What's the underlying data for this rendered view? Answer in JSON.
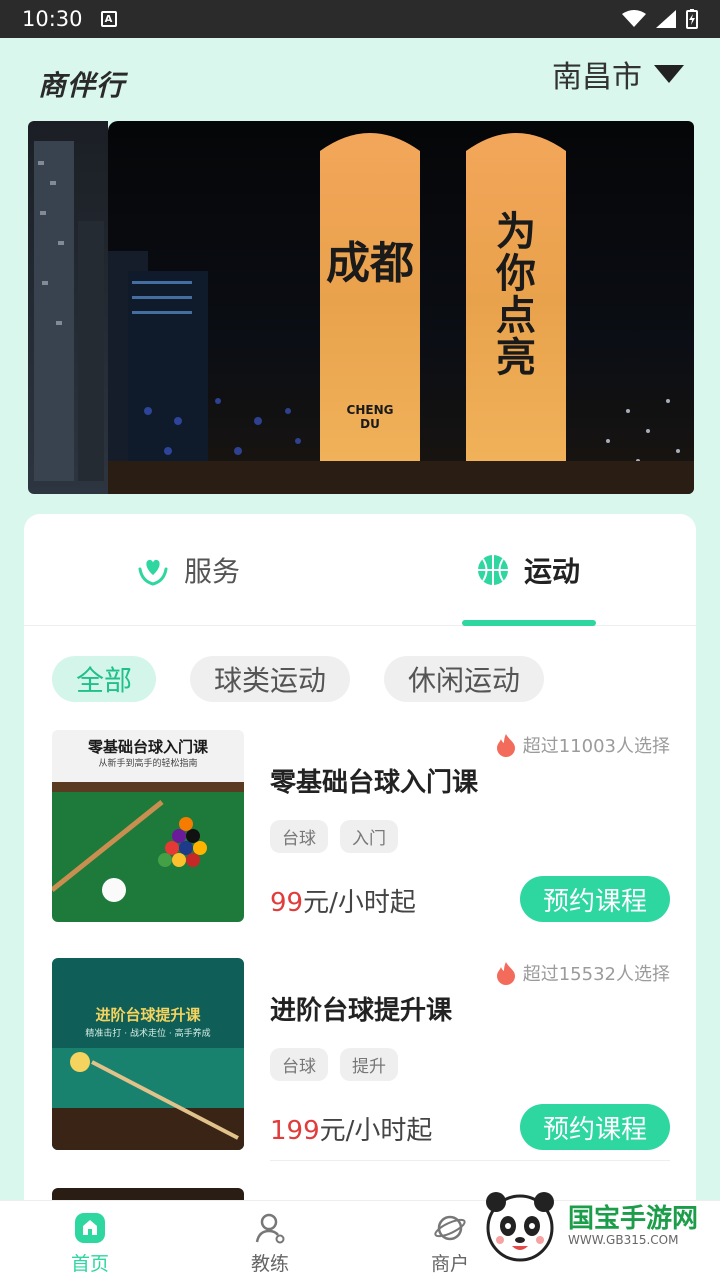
{
  "status_bar": {
    "time": "10:30"
  },
  "header": {
    "app_name": "商伴行",
    "city": "南昌市"
  },
  "tabs": [
    {
      "label": "服务",
      "active": false
    },
    {
      "label": "运动",
      "active": true
    }
  ],
  "filters": [
    {
      "label": "全部",
      "active": true
    },
    {
      "label": "球类运动",
      "active": false
    },
    {
      "label": "休闲运动",
      "active": false
    }
  ],
  "courses": [
    {
      "title": "零基础台球入门课",
      "popularity": "超过11003人选择",
      "tags": [
        "台球",
        "入门"
      ],
      "price": "99",
      "price_unit": "元/小时起",
      "book_label": "预约课程",
      "thumb_title": "零基础台球入门课",
      "thumb_subtitle": "从新手到高手的轻松指南"
    },
    {
      "title": "进阶台球提升课",
      "popularity": "超过15532人选择",
      "tags": [
        "台球",
        "提升"
      ],
      "price": "199",
      "price_unit": "元/小时起",
      "book_label": "预约课程",
      "thumb_title": "进阶台球提升课",
      "thumb_subtitle": "精准击打 · 战术走位 · 高手养成"
    }
  ],
  "bottom_nav": [
    {
      "label": "首页",
      "active": true
    },
    {
      "label": "教练",
      "active": false
    },
    {
      "label": "商户",
      "active": false
    }
  ],
  "banner": {
    "left_text": "成都",
    "right_text": "为你点亮",
    "caption_1": "CHENG",
    "caption_2": "DU"
  },
  "watermark": {
    "name": "国宝手游网",
    "url": "WWW.GB315.COM"
  },
  "colors": {
    "accent": "#2ed6a0",
    "price": "#e23b3b",
    "background": "#d9f7ec"
  }
}
